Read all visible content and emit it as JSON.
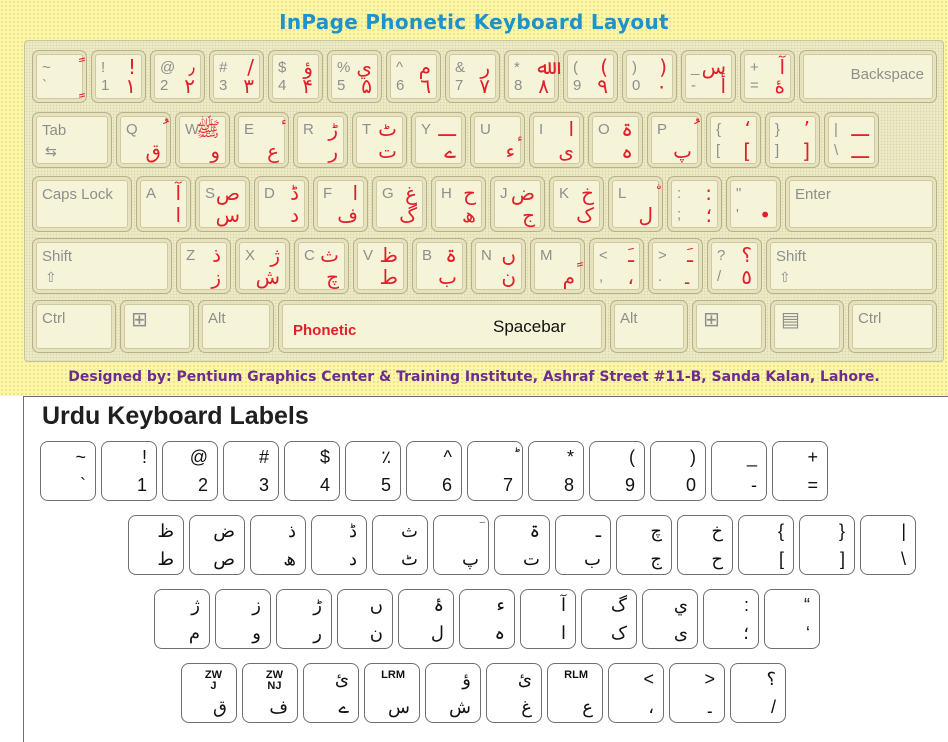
{
  "phonetic": {
    "title": "InPage Phonetic Keyboard Layout",
    "row1": [
      {
        "en_top": "~",
        "en_bottom": "`",
        "ur_top": "ً",
        "ur_bottom": "ٍ"
      },
      {
        "en_top": "!",
        "en_bottom": "1",
        "ur_top": "!",
        "ur_bottom": "١"
      },
      {
        "en_top": "@",
        "en_bottom": "2",
        "ur_top": "٫",
        "ur_bottom": "٢"
      },
      {
        "en_top": "#",
        "en_bottom": "3",
        "ur_top": "/",
        "ur_bottom": "٣"
      },
      {
        "en_top": "$",
        "en_bottom": "4",
        "ur_top": "ؤ",
        "ur_bottom": "۴"
      },
      {
        "en_top": "%",
        "en_bottom": "5",
        "ur_top": "ي",
        "ur_bottom": "۵"
      },
      {
        "en_top": "^",
        "en_bottom": "6",
        "ur_top": "م",
        "ur_bottom": "٦"
      },
      {
        "en_top": "&",
        "en_bottom": "7",
        "ur_top": "ر",
        "ur_bottom": "٧"
      },
      {
        "en_top": "*",
        "en_bottom": "8",
        "ur_top": "ﷲ",
        "ur_bottom": "٨"
      },
      {
        "en_top": "(",
        "en_bottom": "9",
        "ur_top": "(",
        "ur_bottom": "٩"
      },
      {
        "en_top": ")",
        "en_bottom": "0",
        "ur_top": ")",
        "ur_bottom": "٠"
      },
      {
        "en_top": "_",
        "en_bottom": "-",
        "ur_top": "س",
        "ur_bottom": "أ"
      },
      {
        "en_top": "+",
        "en_bottom": "=",
        "ur_top": "آ",
        "ur_bottom": "ۀ"
      }
    ],
    "backspace": "Backspace",
    "tab": "Tab",
    "row2": [
      {
        "en": "Q",
        "ur_top": "ُ",
        "ur_bottom": "ق"
      },
      {
        "en": "W",
        "ur_top": "ﷺ",
        "ur_bottom": "و"
      },
      {
        "en": "E",
        "ur_top": "ٔ",
        "ur_bottom": "ع"
      },
      {
        "en": "R",
        "ur_top": "ڑ",
        "ur_bottom": "ر"
      },
      {
        "en": "T",
        "ur_top": "ٹ",
        "ur_bottom": "ت"
      },
      {
        "en": "Y",
        "ur_top": "ـــ",
        "ur_bottom": "ے"
      },
      {
        "en": "U",
        "ur_top": "ٕ",
        "ur_bottom": "ء"
      },
      {
        "en": "I",
        "ur_top": "ا",
        "ur_bottom": "ی"
      },
      {
        "en": "O",
        "ur_top": "ۃ",
        "ur_bottom": "ہ"
      },
      {
        "en": "P",
        "ur_top": "ُ",
        "ur_bottom": "پ"
      },
      {
        "en_top": "{",
        "en_bottom": "[",
        "ur_top": "‘",
        "ur_bottom": "["
      },
      {
        "en_top": "}",
        "en_bottom": "]",
        "ur_top": "’",
        "ur_bottom": "]"
      },
      {
        "en_top": "|",
        "en_bottom": "\\",
        "ur_top": "ـــ",
        "ur_bottom": "ـــ"
      }
    ],
    "capslock": "Caps Lock",
    "enter": "Enter",
    "row3": [
      {
        "en": "A",
        "ur_top": "آ",
        "ur_bottom": "ا"
      },
      {
        "en": "S",
        "ur_top": "ص",
        "ur_bottom": "س"
      },
      {
        "en": "D",
        "ur_top": "ڈ",
        "ur_bottom": "د"
      },
      {
        "en": "F",
        "ur_top": "ا",
        "ur_bottom": "ف"
      },
      {
        "en": "G",
        "ur_top": "غ",
        "ur_bottom": "گ"
      },
      {
        "en": "H",
        "ur_top": "ح",
        "ur_bottom": "ھ"
      },
      {
        "en": "J",
        "ur_top": "ض",
        "ur_bottom": "ج"
      },
      {
        "en": "K",
        "ur_top": "خ",
        "ur_bottom": "ک"
      },
      {
        "en": "L",
        "ur_top": "ۨ",
        "ur_bottom": "ل"
      },
      {
        "en_top": ":",
        "en_bottom": ";",
        "ur_top": ":",
        "ur_bottom": "؛"
      },
      {
        "en_top": "\"",
        "en_bottom": "'",
        "ur_top": "",
        "ur_bottom": "•"
      }
    ],
    "shift": "Shift",
    "row4": [
      {
        "en": "Z",
        "ur_top": "ذ",
        "ur_bottom": "ز"
      },
      {
        "en": "X",
        "ur_top": "ژ",
        "ur_bottom": "ش"
      },
      {
        "en": "C",
        "ur_top": "ث",
        "ur_bottom": "چ"
      },
      {
        "en": "V",
        "ur_top": "ظ",
        "ur_bottom": "ط"
      },
      {
        "en": "B",
        "ur_top": "ۃ",
        "ur_bottom": "ب"
      },
      {
        "en": "N",
        "ur_top": "ں",
        "ur_bottom": "ن"
      },
      {
        "en": "M",
        "ur_top": "ٍ",
        "ur_bottom": "م"
      },
      {
        "en_top": "<",
        "en_bottom": ",",
        "ur_top": "ـَ",
        "ur_bottom": "،"
      },
      {
        "en_top": ">",
        "en_bottom": ".",
        "ur_top": "ـَ",
        "ur_bottom": "۔"
      },
      {
        "en_top": "?",
        "en_bottom": "/",
        "ur_top": "؟",
        "ur_bottom": "٥"
      }
    ],
    "ctrl": "Ctrl",
    "alt": "Alt",
    "phonetic_label": "Phonetic",
    "spacebar": "Spacebar",
    "designer": "Designed by: Pentium Graphics Center & Training Institute, Ashraf Street #11-B, Sanda Kalan, Lahore."
  },
  "labels": {
    "title": "Urdu Keyboard Labels",
    "row1": [
      {
        "top": "~",
        "bottom": "`"
      },
      {
        "top": "!",
        "bottom": "1"
      },
      {
        "top": "@",
        "bottom": "2"
      },
      {
        "top": "#",
        "bottom": "3"
      },
      {
        "top": "$",
        "bottom": "4"
      },
      {
        "top": "٪",
        "bottom": "5"
      },
      {
        "top": "^",
        "bottom": "6"
      },
      {
        "top": "ؕ",
        "bottom": "7"
      },
      {
        "top": "*",
        "bottom": "8"
      },
      {
        "top": "(",
        "bottom": "9"
      },
      {
        "top": ")",
        "bottom": "0"
      },
      {
        "top": "_",
        "bottom": "-"
      },
      {
        "top": "+",
        "bottom": "="
      }
    ],
    "row2": [
      {
        "top": "ظ",
        "bottom": "ط"
      },
      {
        "top": "ض",
        "bottom": "ص"
      },
      {
        "top": "ذ",
        "bottom": "ھ"
      },
      {
        "top": "ڈ",
        "bottom": "د"
      },
      {
        "top": "ث",
        "bottom": "ٹ"
      },
      {
        "top": "ؔ",
        "bottom": "پ"
      },
      {
        "top": "ۃ",
        "bottom": "ت"
      },
      {
        "top": "ـ",
        "bottom": "ب"
      },
      {
        "top": "چ",
        "bottom": "ج"
      },
      {
        "top": "خ",
        "bottom": "ح"
      },
      {
        "top": "{",
        "bottom": "["
      },
      {
        "top": "}",
        "bottom": "]"
      },
      {
        "top": "|",
        "bottom": "\\"
      }
    ],
    "row3": [
      {
        "top": "ژ",
        "bottom": "م"
      },
      {
        "top": "ز",
        "bottom": "و"
      },
      {
        "top": "ڑ",
        "bottom": "ر"
      },
      {
        "top": "ں",
        "bottom": "ن"
      },
      {
        "top": "ۂ",
        "bottom": "ل"
      },
      {
        "top": "ء",
        "bottom": "ہ"
      },
      {
        "top": "آ",
        "bottom": "ا"
      },
      {
        "top": "گ",
        "bottom": "ک"
      },
      {
        "top": "ي",
        "bottom": "ی"
      },
      {
        "top": ":",
        "bottom": "؛"
      },
      {
        "top": "“",
        "bottom": "‘"
      }
    ],
    "row4": [
      {
        "top": "ZW\nJ",
        "bottom": "ق",
        "small": true
      },
      {
        "top": "ZW\nNJ",
        "bottom": "ف",
        "small": true
      },
      {
        "top": "ئ",
        "bottom": "ے"
      },
      {
        "top": "LRM",
        "bottom": "س",
        "small": true
      },
      {
        "top": "ؤ",
        "bottom": "ش"
      },
      {
        "top": "ئ",
        "bottom": "غ"
      },
      {
        "top": "RLM",
        "bottom": "ع",
        "small": true
      },
      {
        "top": "<",
        "bottom": "،"
      },
      {
        "top": ">",
        "bottom": "۔"
      },
      {
        "top": "؟",
        "bottom": "/"
      }
    ]
  }
}
